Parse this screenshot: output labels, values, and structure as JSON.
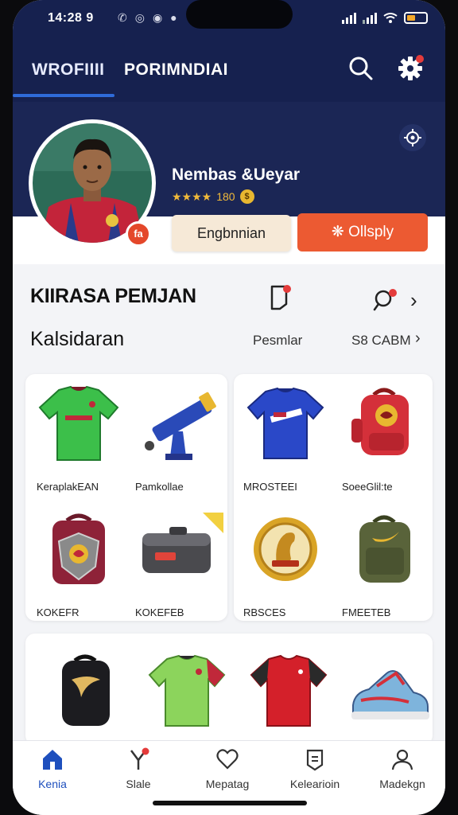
{
  "status_bar": {
    "time": "14:28 9",
    "notification_icons": [
      "message-icon",
      "whatsapp-icon",
      "eye-icon",
      "dot-icon"
    ]
  },
  "header": {
    "tabs": [
      {
        "label": "WROFIIII",
        "active": true
      },
      {
        "label": "PORIMNDIAI",
        "active": false
      }
    ],
    "accent": "#2f6bd9",
    "background": "#16214f"
  },
  "profile": {
    "name": "Nembas &Ueyar",
    "stars": "★★★★",
    "rating": "180",
    "coin_label": "$",
    "badge_label": "fa",
    "buttons": {
      "secondary": "Engbnnian",
      "primary": "Ollsply"
    },
    "primary_color": "#ec5a32"
  },
  "section": {
    "title": "KIIRASA PEMJAN",
    "subtitle": "Kalsidaran",
    "filter_label": "Pesmlar",
    "sort_label": "S8 CABM"
  },
  "products_card_a": [
    {
      "label": "KeraplakEAN",
      "icon": "green-jersey"
    },
    {
      "label": "Pamkollae",
      "icon": "blue-trophy"
    },
    {
      "label": "KOKEFR",
      "icon": "red-backpack-shield"
    },
    {
      "label": "KOKEFEB",
      "icon": "gray-case"
    }
  ],
  "products_card_b": [
    {
      "label": "MROSTEEI",
      "icon": "blue-jersey"
    },
    {
      "label": "SoeeGlil:te",
      "icon": "red-backpack"
    },
    {
      "label": "RBSCES",
      "icon": "gold-medal"
    },
    {
      "label": "FMEETEB",
      "icon": "olive-backpack"
    }
  ],
  "products_card_c": [
    {
      "icon": "black-backpack"
    },
    {
      "icon": "lime-jersey"
    },
    {
      "icon": "red-jersey"
    },
    {
      "icon": "sneaker"
    }
  ],
  "bottom_nav": [
    {
      "label": "Kenia",
      "icon": "home-icon",
      "active": true
    },
    {
      "label": "Slale",
      "icon": "slingshot-icon",
      "active": false
    },
    {
      "label": "Mepatag",
      "icon": "heart-icon",
      "active": false
    },
    {
      "label": "Kelearioin",
      "icon": "badge-icon",
      "active": false
    },
    {
      "label": "Madekgn",
      "icon": "user-icon",
      "active": false
    }
  ]
}
